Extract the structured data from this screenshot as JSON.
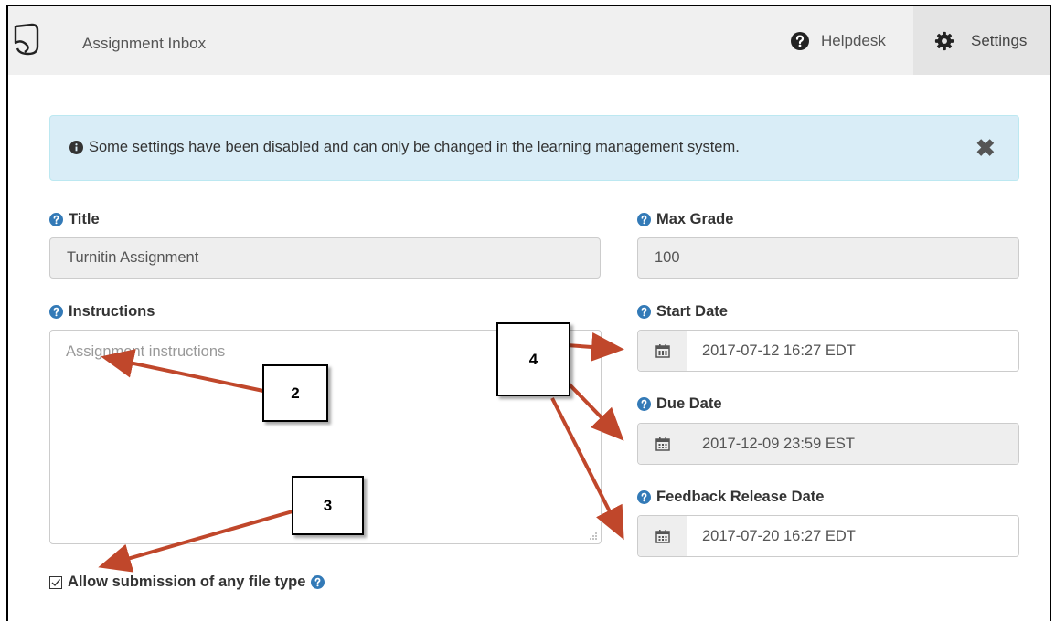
{
  "navbar": {
    "app_title": "Assignment Inbox",
    "helpdesk_label": "Helpdesk",
    "settings_label": "Settings"
  },
  "alert": {
    "text": "Some settings have been disabled and can only be changed in the learning management system.",
    "close_glyph": "✖"
  },
  "form": {
    "title_label": "Title",
    "title_value": "Turnitin Assignment",
    "max_grade_label": "Max Grade",
    "max_grade_value": "100",
    "instructions_label": "Instructions",
    "instructions_placeholder": "Assignment instructions",
    "start_date_label": "Start Date",
    "start_date_value": "2017-07-12 16:27 EDT",
    "due_date_label": "Due Date",
    "due_date_value": "2017-12-09 23:59 EST",
    "feedback_label": "Feedback Release Date",
    "feedback_value": "2017-07-20 16:27 EDT",
    "allow_any_file_label": "Allow submission of any file type",
    "allow_any_file_checked": true
  },
  "callouts": {
    "c2": "2",
    "c3": "3",
    "c4": "4"
  },
  "colors": {
    "accent_blue": "#337ab7",
    "alert_bg": "#d9edf7",
    "arrow": "#c0472b"
  }
}
